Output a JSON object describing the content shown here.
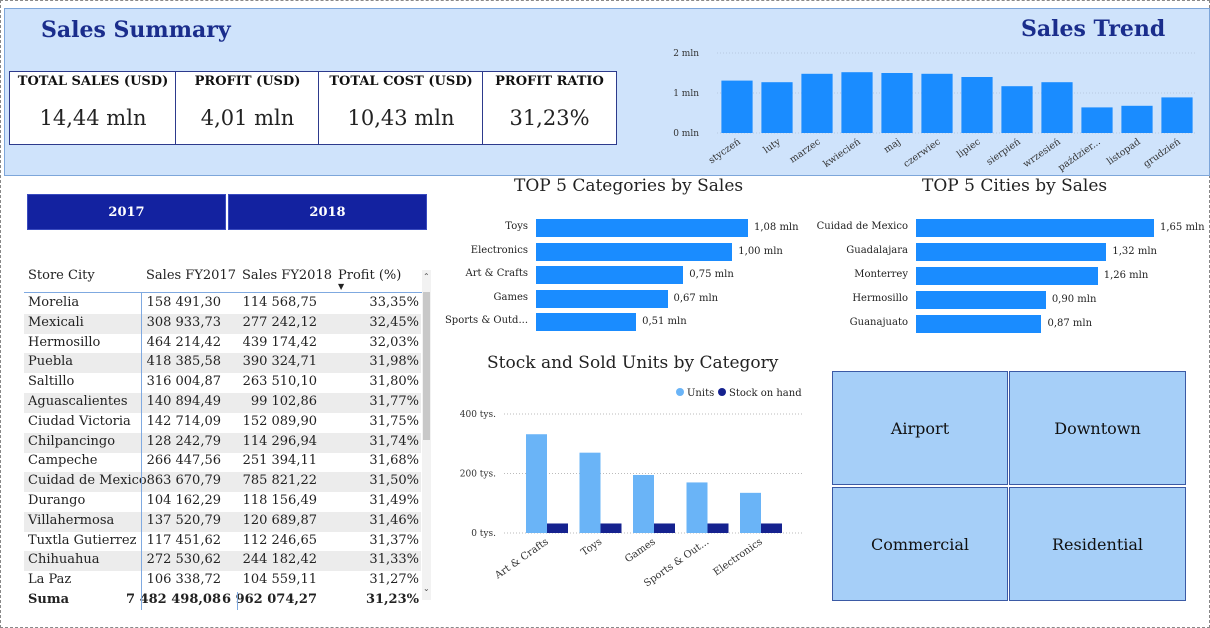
{
  "header": {
    "summary_title": "Sales Summary",
    "trend_title": "Sales Trend",
    "kpis": [
      {
        "label": "TOTAL SALES (USD)",
        "value": "14,44 mln"
      },
      {
        "label": "PROFIT (USD)",
        "value": "4,01 mln"
      },
      {
        "label": "TOTAL COST (USD)",
        "value": "10,43 mln"
      },
      {
        "label": "PROFIT RATIO",
        "value": "31,23%"
      }
    ]
  },
  "year_buttons": [
    "2017",
    "2018"
  ],
  "table": {
    "headers": [
      "Store City",
      "Sales FY2017",
      "Sales FY2018",
      "Profit (%)"
    ],
    "rows": [
      [
        "Morelia",
        "158 491,30",
        "114 568,75",
        "33,35%"
      ],
      [
        "Mexicali",
        "308 933,73",
        "277 242,12",
        "32,45%"
      ],
      [
        "Hermosillo",
        "464 214,42",
        "439 174,42",
        "32,03%"
      ],
      [
        "Puebla",
        "418 385,58",
        "390 324,71",
        "31,98%"
      ],
      [
        "Saltillo",
        "316 004,87",
        "263 510,10",
        "31,80%"
      ],
      [
        "Aguascalientes",
        "140 894,49",
        "99 102,86",
        "31,77%"
      ],
      [
        "Ciudad Victoria",
        "142 714,09",
        "152 089,90",
        "31,75%"
      ],
      [
        "Chilpancingo",
        "128 242,79",
        "114 296,94",
        "31,74%"
      ],
      [
        "Campeche",
        "266 447,56",
        "251 394,11",
        "31,68%"
      ],
      [
        "Cuidad de Mexico",
        "863 670,79",
        "785 821,22",
        "31,50%"
      ],
      [
        "Durango",
        "104 162,29",
        "118 156,49",
        "31,49%"
      ],
      [
        "Villahermosa",
        "137 520,79",
        "120 689,87",
        "31,46%"
      ],
      [
        "Tuxtla Gutierrez",
        "117 451,62",
        "112 246,65",
        "31,37%"
      ],
      [
        "Chihuahua",
        "272 530,62",
        "244 182,42",
        "31,33%"
      ],
      [
        "La Paz",
        "106 338,72",
        "104 559,11",
        "31,27%"
      ]
    ],
    "total": [
      "Suma",
      "7 482 498,08",
      "6 962 074,27",
      "31,23%"
    ]
  },
  "top_categories": {
    "title": "TOP 5 Categories by Sales",
    "items": [
      {
        "label": "Toys",
        "value": 1.08,
        "text": "1,08 mln"
      },
      {
        "label": "Electronics",
        "value": 1.0,
        "text": "1,00 mln"
      },
      {
        "label": "Art & Crafts",
        "value": 0.75,
        "text": "0,75 mln"
      },
      {
        "label": "Games",
        "value": 0.67,
        "text": "0,67 mln"
      },
      {
        "label": "Sports & Outd...",
        "value": 0.51,
        "text": "0,51 mln"
      }
    ]
  },
  "top_cities": {
    "title": "TOP 5 Cities by Sales",
    "items": [
      {
        "label": "Cuidad de Mexico",
        "value": 1.65,
        "text": "1,65 mln"
      },
      {
        "label": "Guadalajara",
        "value": 1.32,
        "text": "1,32 mln"
      },
      {
        "label": "Monterrey",
        "value": 1.26,
        "text": "1,26 mln"
      },
      {
        "label": "Hermosillo",
        "value": 0.9,
        "text": "0,90 mln"
      },
      {
        "label": "Guanajuato",
        "value": 0.87,
        "text": "0,87 mln"
      }
    ]
  },
  "stock_title": "Stock and Sold Units by Category",
  "tiles": [
    "Airport",
    "Downtown",
    "Commercial",
    "Residential"
  ],
  "colors": {
    "bar": "#1a8cff",
    "units": "#6ab4f7",
    "stock": "#15228f",
    "dark": "#1322a0"
  },
  "chart_data": [
    {
      "type": "bar",
      "categories": [
        "styczeń",
        "luty",
        "marzec",
        "kwiecień",
        "maj",
        "czerwiec",
        "lipiec",
        "sierpień",
        "wrzesień",
        "październik",
        "listopad",
        "grudzień"
      ],
      "category_labels": [
        "styczeń",
        "luty",
        "marzec",
        "kwiecień",
        "maj",
        "czerwiec",
        "lipiec",
        "sierpień",
        "wrzesień",
        "paździer...",
        "listopad",
        "grudzień"
      ],
      "values": [
        1.31,
        1.27,
        1.48,
        1.52,
        1.5,
        1.48,
        1.4,
        1.17,
        1.27,
        0.64,
        0.68,
        0.89
      ],
      "title": "Sales Trend",
      "yticks": [
        "0 mln",
        "1 mln",
        "2 mln"
      ],
      "ylim": [
        0,
        2
      ],
      "grid": true
    },
    {
      "type": "bar",
      "title": "Stock and Sold Units by Category",
      "categories": [
        "Art & Crafts",
        "Toys",
        "Games",
        "Sports & Out...",
        "Electronics"
      ],
      "series": [
        {
          "name": "Units",
          "values": [
            332000,
            270000,
            195000,
            170000,
            135000
          ]
        },
        {
          "name": "Stock on hand",
          "values": [
            32000,
            32000,
            32000,
            32000,
            32000
          ]
        }
      ],
      "yticks": [
        "0 tys.",
        "200 tys.",
        "400 tys."
      ],
      "ylim": [
        0,
        400000
      ],
      "legend": "top-right",
      "grid": true
    }
  ]
}
